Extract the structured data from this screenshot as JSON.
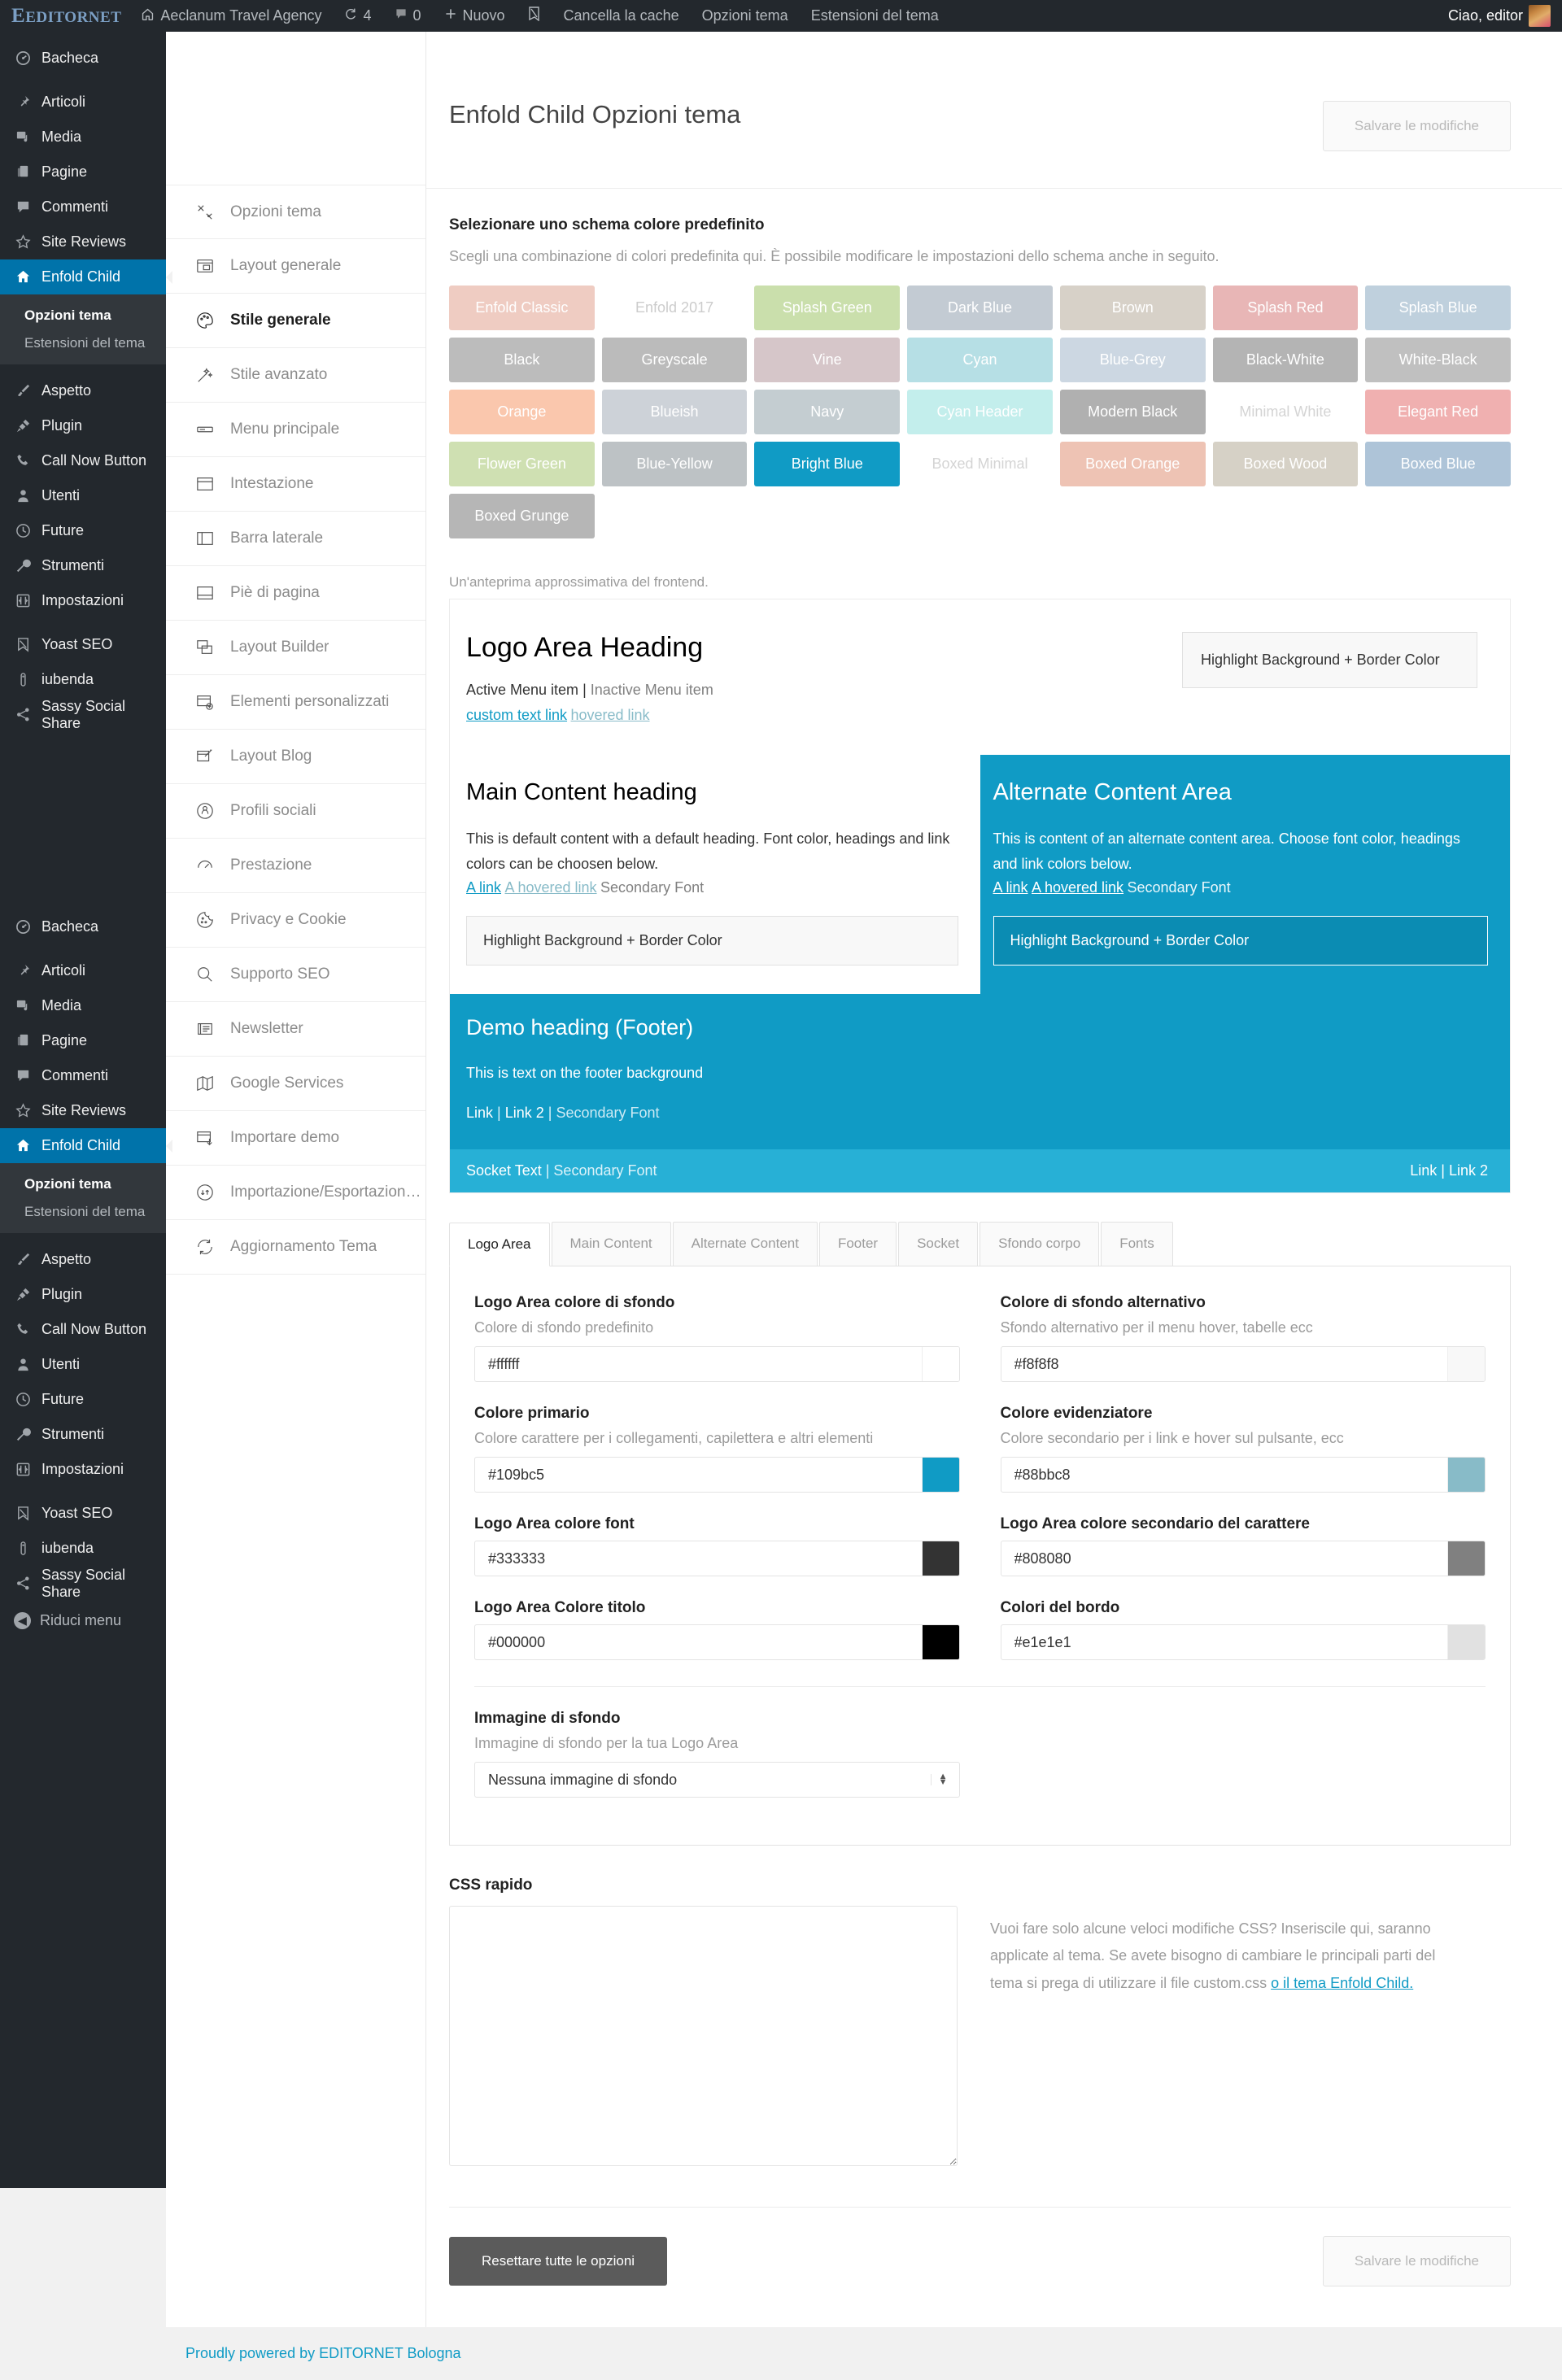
{
  "adminbar": {
    "logo": "EDITORNET",
    "site_name": "Aeclanum Travel Agency",
    "updates_count": "4",
    "comments_count": "0",
    "new_label": "Nuovo",
    "yoast_label": "",
    "clear_cache": "Cancella la cache",
    "theme_options": "Opzioni tema",
    "theme_extensions": "Estensioni del tema",
    "greeting": "Ciao, editor"
  },
  "sidebar": {
    "items": [
      {
        "label": "Bacheca",
        "icon": "dashboard-icon",
        "current": false
      },
      {
        "label": "Articoli",
        "icon": "pin-icon",
        "current": false
      },
      {
        "label": "Media",
        "icon": "media-icon",
        "current": false
      },
      {
        "label": "Pagine",
        "icon": "pages-icon",
        "current": false
      },
      {
        "label": "Commenti",
        "icon": "comment-icon",
        "current": false
      },
      {
        "label": "Site Reviews",
        "icon": "star-icon",
        "current": false
      },
      {
        "label": "Enfold Child",
        "icon": "home-icon",
        "current": true
      }
    ],
    "submenu": [
      {
        "label": "Opzioni tema",
        "current": true
      },
      {
        "label": "Estensioni del tema",
        "current": false
      }
    ],
    "items2": [
      {
        "label": "Aspetto",
        "icon": "brush-icon"
      },
      {
        "label": "Plugin",
        "icon": "plug-icon"
      },
      {
        "label": "Call Now Button",
        "icon": "phone-icon"
      },
      {
        "label": "Utenti",
        "icon": "user-icon"
      },
      {
        "label": "Future",
        "icon": "clock-icon"
      },
      {
        "label": "Strumenti",
        "icon": "wrench-icon"
      },
      {
        "label": "Impostazioni",
        "icon": "settings-icon"
      }
    ],
    "items3": [
      {
        "label": "Yoast SEO",
        "icon": "yoast-icon"
      },
      {
        "label": "iubenda",
        "icon": "iubenda-icon"
      },
      {
        "label": "Sassy Social Share",
        "icon": "share-icon"
      }
    ],
    "collapse": "Riduci menu"
  },
  "theme_nav": [
    {
      "label": "Opzioni tema",
      "icon": "tools-icon",
      "active": false
    },
    {
      "label": "Layout generale",
      "icon": "layout-icon",
      "active": false
    },
    {
      "label": "Stile generale",
      "icon": "palette-icon",
      "active": true
    },
    {
      "label": "Stile avanzato",
      "icon": "wand-icon",
      "active": false
    },
    {
      "label": "Menu principale",
      "icon": "menubar-icon",
      "active": false
    },
    {
      "label": "Intestazione",
      "icon": "header-icon",
      "active": false
    },
    {
      "label": "Barra laterale",
      "icon": "sidebar-icon",
      "active": false
    },
    {
      "label": "Piè di pagina",
      "icon": "footer-icon",
      "active": false
    },
    {
      "label": "Layout Builder",
      "icon": "builder-icon",
      "active": false
    },
    {
      "label": "Elementi personalizzati",
      "icon": "custom-icon",
      "active": false
    },
    {
      "label": "Layout Blog",
      "icon": "blog-icon",
      "active": false
    },
    {
      "label": "Profili sociali",
      "icon": "social-icon",
      "active": false
    },
    {
      "label": "Prestazione",
      "icon": "gauge-icon",
      "active": false
    },
    {
      "label": "Privacy e Cookie",
      "icon": "cookie-icon",
      "active": false
    },
    {
      "label": "Supporto SEO",
      "icon": "search-icon",
      "active": false
    },
    {
      "label": "Newsletter",
      "icon": "newsletter-icon",
      "active": false
    },
    {
      "label": "Google Services",
      "icon": "map-icon",
      "active": false
    },
    {
      "label": "Importare demo",
      "icon": "import-demo-icon",
      "active": false
    },
    {
      "label": "Importazione/Esportazione/...",
      "icon": "impexp-icon",
      "active": false
    },
    {
      "label": "Aggiornamento Tema",
      "icon": "refresh-icon",
      "active": false
    }
  ],
  "page": {
    "title": "Enfold Child Opzioni tema",
    "save_label": "Salvare le modifiche",
    "reset_label": "Resettare tutte le opzioni"
  },
  "scheme_section": {
    "title": "Selezionare uno schema colore predefinito",
    "desc": "Scegli una combinazione di colori predefinita qui. È possibile modificare le impostazioni dello schema anche in seguito.",
    "schemes": [
      {
        "label": "Enfold Classic",
        "bg": "#efccc2",
        "fg": "#ffffff",
        "active": false
      },
      {
        "label": "Enfold 2017",
        "bg": "#ffffff",
        "fg": "#cccccc",
        "active": false
      },
      {
        "label": "Splash Green",
        "bg": "#cadfac",
        "fg": "#ffffff",
        "active": false
      },
      {
        "label": "Dark Blue",
        "bg": "#c3cbd3",
        "fg": "#ffffff",
        "active": false
      },
      {
        "label": "Brown",
        "bg": "#d7d1c8",
        "fg": "#ffffff",
        "active": false
      },
      {
        "label": "Splash Red",
        "bg": "#e8b6b6",
        "fg": "#ffffff",
        "active": false
      },
      {
        "label": "Splash Blue",
        "bg": "#bfd0dd",
        "fg": "#ffffff",
        "active": false
      },
      {
        "label": "Black",
        "bg": "#bcbcbc",
        "fg": "#ffffff",
        "active": false
      },
      {
        "label": "Greyscale",
        "bg": "#bbbbbb",
        "fg": "#ffffff",
        "active": false
      },
      {
        "label": "Vine",
        "bg": "#d6c6c9",
        "fg": "#ffffff",
        "active": false
      },
      {
        "label": "Cyan",
        "bg": "#b6dfe5",
        "fg": "#ffffff",
        "active": false
      },
      {
        "label": "Blue-Grey",
        "bg": "#ccd7e2",
        "fg": "#ffffff",
        "active": false
      },
      {
        "label": "Black-White",
        "bg": "#b4b4b4",
        "fg": "#ffffff",
        "active": false
      },
      {
        "label": "White-Black",
        "bg": "#c0c0c0",
        "fg": "#ffffff",
        "active": false
      },
      {
        "label": "Orange",
        "bg": "#fac7ad",
        "fg": "#ffffff",
        "active": false
      },
      {
        "label": "Blueish",
        "bg": "#cdd2d8",
        "fg": "#ffffff",
        "active": false
      },
      {
        "label": "Navy",
        "bg": "#c4cdd1",
        "fg": "#ffffff",
        "active": false
      },
      {
        "label": "Cyan Header",
        "bg": "#c3eeec",
        "fg": "#ffffff",
        "active": false
      },
      {
        "label": "Modern Black",
        "bg": "#b0b0b0",
        "fg": "#ffffff",
        "active": false
      },
      {
        "label": "Minimal White",
        "bg": "#ffffff",
        "fg": "#d4d4d4",
        "active": false
      },
      {
        "label": "Elegant Red",
        "bg": "#f0b0b0",
        "fg": "#ffffff",
        "active": false
      },
      {
        "label": "Flower Green",
        "bg": "#cfe0b2",
        "fg": "#ffffff",
        "active": false
      },
      {
        "label": "Blue-Yellow",
        "bg": "#bdc2c5",
        "fg": "#ffffff",
        "active": false
      },
      {
        "label": "Bright Blue",
        "bg": "#109bc5",
        "fg": "#ffffff",
        "active": true
      },
      {
        "label": "Boxed Minimal",
        "bg": "#ffffff",
        "fg": "#d4d4d4",
        "active": false
      },
      {
        "label": "Boxed Orange",
        "bg": "#eec3b4",
        "fg": "#ffffff",
        "active": false
      },
      {
        "label": "Boxed Wood",
        "bg": "#d6d1c6",
        "fg": "#ffffff",
        "active": false
      },
      {
        "label": "Boxed Blue",
        "bg": "#aec4d8",
        "fg": "#ffffff",
        "active": false
      },
      {
        "label": "Boxed Grunge",
        "bg": "#b6b6b6",
        "fg": "#ffffff",
        "active": false
      }
    ]
  },
  "preview": {
    "note": "Un'anteprima approssimativa del frontend.",
    "logo_heading": "Logo Area Heading",
    "menu_active": "Active Menu item",
    "menu_sep": " | ",
    "menu_inactive": "Inactive Menu item",
    "custom_text_link": "custom text link",
    "hovered_link": "hovered link",
    "highlight_box": "Highlight Background + Border Color",
    "main_heading": "Main Content heading",
    "main_text": "This is default content with a default heading. Font color, headings and link colors can be choosen below.",
    "alt_heading": "Alternate Content Area",
    "alt_text": "This is content of an alternate content area. Choose font color, headings and link colors below.",
    "link_a": "A link",
    "link_hover": "A hovered link",
    "secondary_font": "Secondary Font",
    "highlight_inner": "Highlight Background + Border Color",
    "footer_heading": "Demo heading (Footer)",
    "footer_text": "This is text on the footer background",
    "footer_link1": "Link",
    "footer_link2": "Link 2",
    "footer_secondary": "Secondary Font",
    "socket_text": "Socket Text",
    "socket_secondary": "Secondary Font",
    "socket_link1": "Link",
    "socket_link2": "Link 2"
  },
  "option_tabs": [
    {
      "label": "Logo Area",
      "active": true
    },
    {
      "label": "Main Content",
      "active": false
    },
    {
      "label": "Alternate Content",
      "active": false
    },
    {
      "label": "Footer",
      "active": false
    },
    {
      "label": "Socket",
      "active": false
    },
    {
      "label": "Sfondo corpo",
      "active": false
    },
    {
      "label": "Fonts",
      "active": false
    }
  ],
  "fields": [
    {
      "label": "Logo Area colore di sfondo",
      "hint": "Colore di sfondo predefinito",
      "value": "#ffffff",
      "swatch": "#ffffff"
    },
    {
      "label": "Colore di sfondo alternativo",
      "hint": "Sfondo alternativo per il menu hover, tabelle ecc",
      "value": "#f8f8f8",
      "swatch": "#f8f8f8"
    },
    {
      "label": "Colore primario",
      "hint": "Colore carattere per i collegamenti, capilettera e altri elementi",
      "value": "#109bc5",
      "swatch": "#109bc5"
    },
    {
      "label": "Colore evidenziatore",
      "hint": "Colore secondario per i link e hover sul pulsante, ecc",
      "value": "#88bbc8",
      "swatch": "#88bbc8"
    },
    {
      "label": "Logo Area colore font",
      "hint": "",
      "value": "#333333",
      "swatch": "#333333"
    },
    {
      "label": "Logo Area colore secondario del carattere",
      "hint": "",
      "value": "#808080",
      "swatch": "#808080"
    },
    {
      "label": "Logo Area Colore titolo",
      "hint": "",
      "value": "#000000",
      "swatch": "#000000"
    },
    {
      "label": "Colori del bordo",
      "hint": "",
      "value": "#e1e1e1",
      "swatch": "#e1e1e1"
    }
  ],
  "bg_image": {
    "label": "Immagine di sfondo",
    "hint": "Immagine di sfondo per la tua Logo Area",
    "selected": "Nessuna immagine di sfondo"
  },
  "quick_css": {
    "label": "CSS rapido",
    "value": "",
    "help_1": "Vuoi fare solo alcune veloci modifiche CSS? Inseriscile qui, saranno applicate al tema. Se avete bisogno di cambiare le principali parti del tema si prega di utilizzare il file custom.css ",
    "help_link": "o il tema Enfold Child."
  },
  "wpfooter": {
    "text": "Proudly powered by EDITORNET Bologna"
  }
}
